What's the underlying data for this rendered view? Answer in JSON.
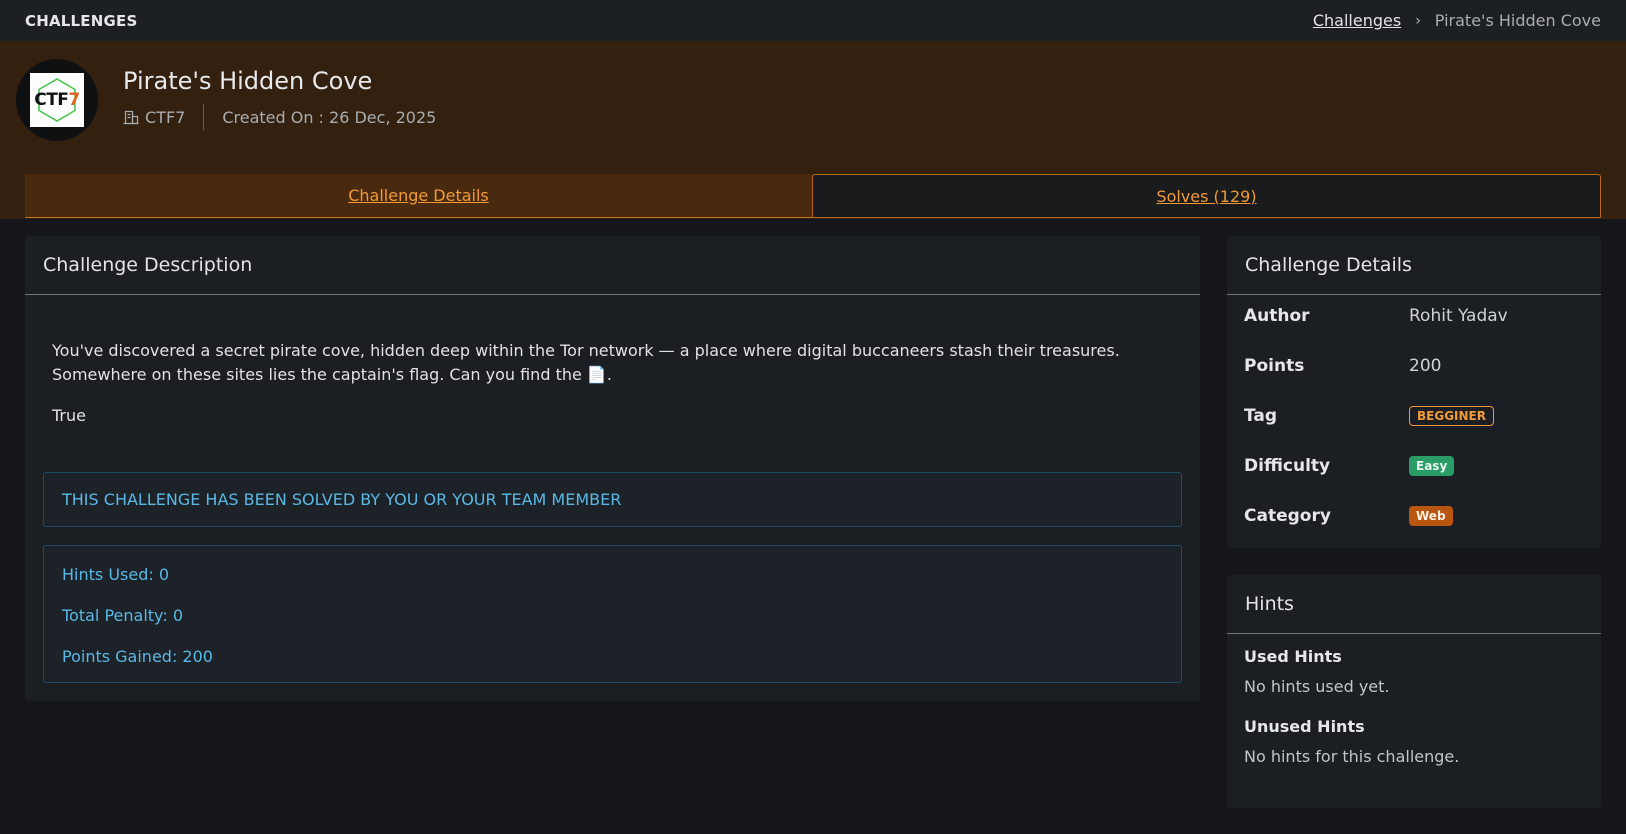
{
  "topbar": {
    "title": "CHALLENGES",
    "breadcrumb": {
      "link": "Challenges",
      "separator": "›",
      "current": "Pirate's Hidden Cove"
    }
  },
  "hero": {
    "logo_text": "CTF",
    "logo_number": "7",
    "title": "Pirate's Hidden Cove",
    "org": "CTF7",
    "created": "Created On : 26 Dec, 2025"
  },
  "tabs": [
    {
      "label": "Challenge Details",
      "active": true
    },
    {
      "label": "Solves (129)",
      "active": false
    }
  ],
  "description": {
    "header": "Challenge Description",
    "text": "You've discovered a secret pirate cove, hidden deep within the Tor network — a place where digital buccaneers stash their treasures. Somewhere on these sites lies the captain's flag. Can you find the 📄.",
    "extra": "True",
    "solved_notice": "THIS CHALLENGE HAS BEEN SOLVED BY YOU OR YOUR TEAM MEMBER",
    "stats": {
      "hints_used": "Hints Used: 0",
      "total_penalty": "Total Penalty: 0",
      "points_gained": "Points Gained: 200"
    }
  },
  "details": {
    "header": "Challenge Details",
    "author_label": "Author",
    "author": "Rohit Yadav",
    "points_label": "Points",
    "points": "200",
    "tag_label": "Tag",
    "tag": "BEGGINER",
    "difficulty_label": "Difficulty",
    "difficulty": "Easy",
    "category_label": "Category",
    "category": "Web"
  },
  "hints": {
    "header": "Hints",
    "used_label": "Used Hints",
    "used_value": "No hints used yet.",
    "unused_label": "Unused Hints",
    "unused_value": "No hints for this challenge."
  },
  "colors": {
    "accent": "#f29a38",
    "info": "#5ab8e6",
    "easy": "#2a9d67",
    "web": "#b8560f"
  }
}
